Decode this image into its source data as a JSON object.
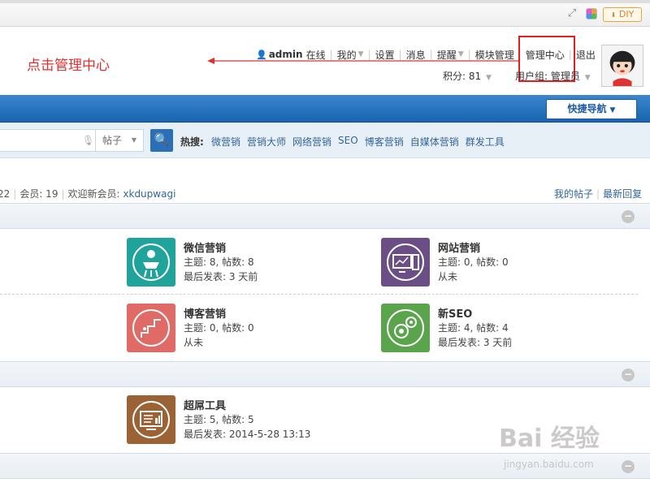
{
  "toolbar": {
    "diy_label": "DIY"
  },
  "annotation": {
    "text": "点击管理中心"
  },
  "user_nav": {
    "username": "admin",
    "status": "在线",
    "items": [
      "我的",
      "设置",
      "消息",
      "提醒",
      "模块管理",
      "管理中心",
      "退出"
    ],
    "points": "积分: 81",
    "group": "用户组: 管理员"
  },
  "quick_nav": {
    "label": "快捷导航"
  },
  "search": {
    "type": "帖子",
    "hot_label": "热搜:",
    "hot_terms": [
      "微营销",
      "营销大师",
      "网络营销",
      "SEO",
      "博客营销",
      "自媒体营销",
      "群发工具"
    ]
  },
  "stats": {
    "posts_fragment": "22",
    "members": "会员: 19",
    "new_member_label": "欢迎新会员:",
    "new_member": "xkdupwagi",
    "my_posts": "我的帖子",
    "latest_replies": "最新回复"
  },
  "forums": [
    {
      "name": "微信营销",
      "stats": "主题: 8, 帖数: 8",
      "last": "最后发表: 3 天前",
      "color": "#1fa39a",
      "icon": "wechat-marketing-icon"
    },
    {
      "name": "网站营销",
      "stats": "主题: 0, 帖数: 0",
      "last": "从未",
      "color": "#6b4e86",
      "icon": "website-marketing-icon"
    },
    {
      "name": "博客营销",
      "stats": "主题: 0, 帖数: 0",
      "last": "从未",
      "color": "#e06a66",
      "icon": "blog-marketing-icon"
    },
    {
      "name": "新SEO",
      "stats": "主题: 4, 帖数: 4",
      "last": "最后发表: 3 天前",
      "color": "#5aa44b",
      "icon": "seo-icon"
    },
    {
      "name": "超屌工具",
      "stats": "主题: 5, 帖数: 5",
      "last": "最后发表: 2014-5-28 13:13",
      "color": "#9a6235",
      "icon": "tools-icon"
    }
  ],
  "watermark": {
    "text": "Bai 经验",
    "sub": "jingyan.baidu.com"
  }
}
